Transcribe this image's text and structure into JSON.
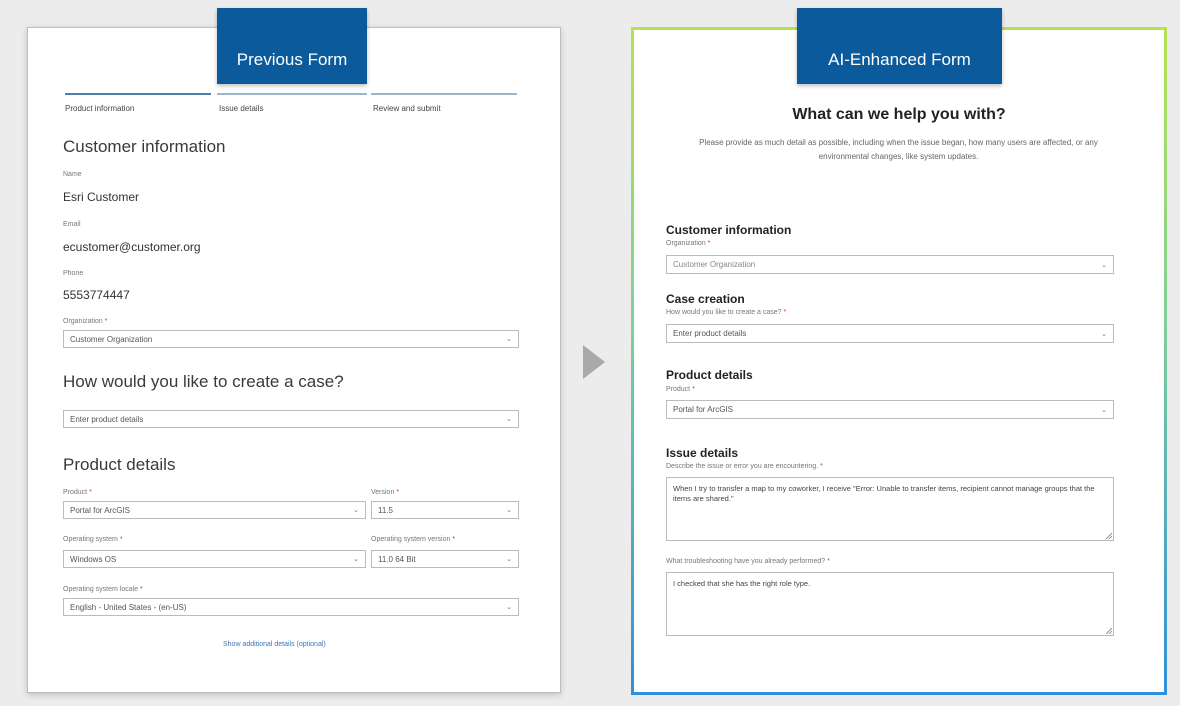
{
  "previous": {
    "tag": "Previous Form",
    "steps": [
      "Product information",
      "Issue details",
      "Review and submit"
    ],
    "customer_heading": "Customer information",
    "name_label": "Name",
    "name_value": "Esri Customer",
    "email_label": "Email",
    "email_value": "ecustomer@customer.org",
    "phone_label": "Phone",
    "phone_value": "5553774447",
    "org_label": "Organization",
    "org_value": "Customer Organization",
    "case_heading": "How would you like to create a case?",
    "case_value": "Enter product details",
    "product_heading": "Product details",
    "product_label": "Product",
    "product_value": "Portal for ArcGIS",
    "version_label": "Version",
    "version_value": "11.5",
    "os_label": "Operating system",
    "os_value": "Windows OS",
    "os_version_label": "Operating system version",
    "os_version_value": "11.0 64 Bit",
    "locale_label": "Operating system locale",
    "locale_value": "English - United States - (en-US)",
    "additional_link": "Show additional details (optional)"
  },
  "enhanced": {
    "tag": "AI-Enhanced Form",
    "title": "What can we help you with?",
    "subtitle": "Please provide as much detail as possible, including when the issue began, how many users are affected, or any environmental changes, like system updates.",
    "customer_heading": "Customer information",
    "org_label": "Organization",
    "org_value": "Customer Organization",
    "case_heading": "Case creation",
    "case_label": "How would you like to create a case?",
    "case_value": "Enter product details",
    "product_heading": "Product details",
    "product_label": "Product",
    "product_value": "Portal for ArcGIS",
    "issue_heading": "Issue details",
    "issue_label": "Describe the issue or error you are encountering.",
    "issue_value": "When I try to transfer a map to my coworker, I receive \"Error: Unable to transfer items, recipient cannot manage groups that the items are shared.\"",
    "troubleshoot_label": "What troubleshooting have you already performed?",
    "troubleshoot_value": "I checked that she has the right role type."
  },
  "required_marker": "*",
  "icons": {
    "chevron": "chevron-down-icon",
    "arrow": "arrow-right-icon"
  },
  "colors": {
    "tag": "#0b5b9c",
    "border_top": "#b6e34c",
    "border_bottom": "#2f8fdc"
  }
}
